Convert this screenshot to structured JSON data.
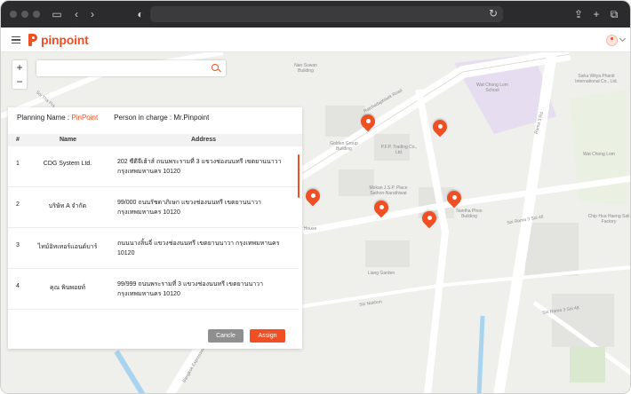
{
  "app": {
    "brand_pin": "pin",
    "brand_point": "point",
    "accent_color": "#f04e23"
  },
  "browser": {
    "url": ""
  },
  "map": {
    "search_placeholder": "",
    "zoom_in": "+",
    "zoom_out": "−",
    "labels": [
      "Nan Suwan Building",
      "Wat Chong Lom School",
      "Saha Witya Phanit International Co., Ltd.",
      "Golden Group Building",
      "P.F.P. Trading Co., Ltd.",
      "Wat Chong Lom",
      "Mokan J.S.P. Place Sathon-Narathiwat",
      "Nantha Phon Building",
      "Chip Hua Haeng Sali Factory",
      "Liang Garden",
      "House",
      "Ratchadaphisek Road",
      "Rama 3 Rd.",
      "Soi Rama 3 Soi 46",
      "Soi Nakhon",
      "Soi Rama 3 Soi 48",
      "Soi Tha Pra",
      "Bangkok Expressway"
    ]
  },
  "panel": {
    "planning_label": "Planning Name : ",
    "planning_value": "PinPoint",
    "person_label": "Person in charge : Mr.Pinpoint",
    "columns": [
      "#",
      "Name",
      "Address"
    ],
    "rows": [
      {
        "num": "1",
        "name": "CDG System Ltd.",
        "address": "202 ซีดีจีเฮ้าส์ ถนนพระรามที่ 3 แขวงช่องนนทรี เขตยานนาวา กรุงเทพมหานคร 10120"
      },
      {
        "num": "2",
        "name": "บริษัท A จำกัด",
        "address": "99/000 ถนนรัชดาภิเษก แขวงช่องนนทรี เขตยานนาวา กรุงเทพมหานคร 10120"
      },
      {
        "num": "3",
        "name": "ไทม์อิทเทอร์แอนด์บาร์",
        "address": "ถนนนางลิ้นจี่ แขวงช่องนนทรี เขตยานนาวา กรุงเทพมหานคร 10120"
      },
      {
        "num": "4",
        "name": "คุณ พินพอยท์",
        "address": "99/999 ถนนพระรามที่ 3 แขวงช่องนนทรี เขตยานนาวา กรุงเทพมหานคร 10120"
      }
    ],
    "cancel_label": "Cancle",
    "assign_label": "Assign"
  }
}
